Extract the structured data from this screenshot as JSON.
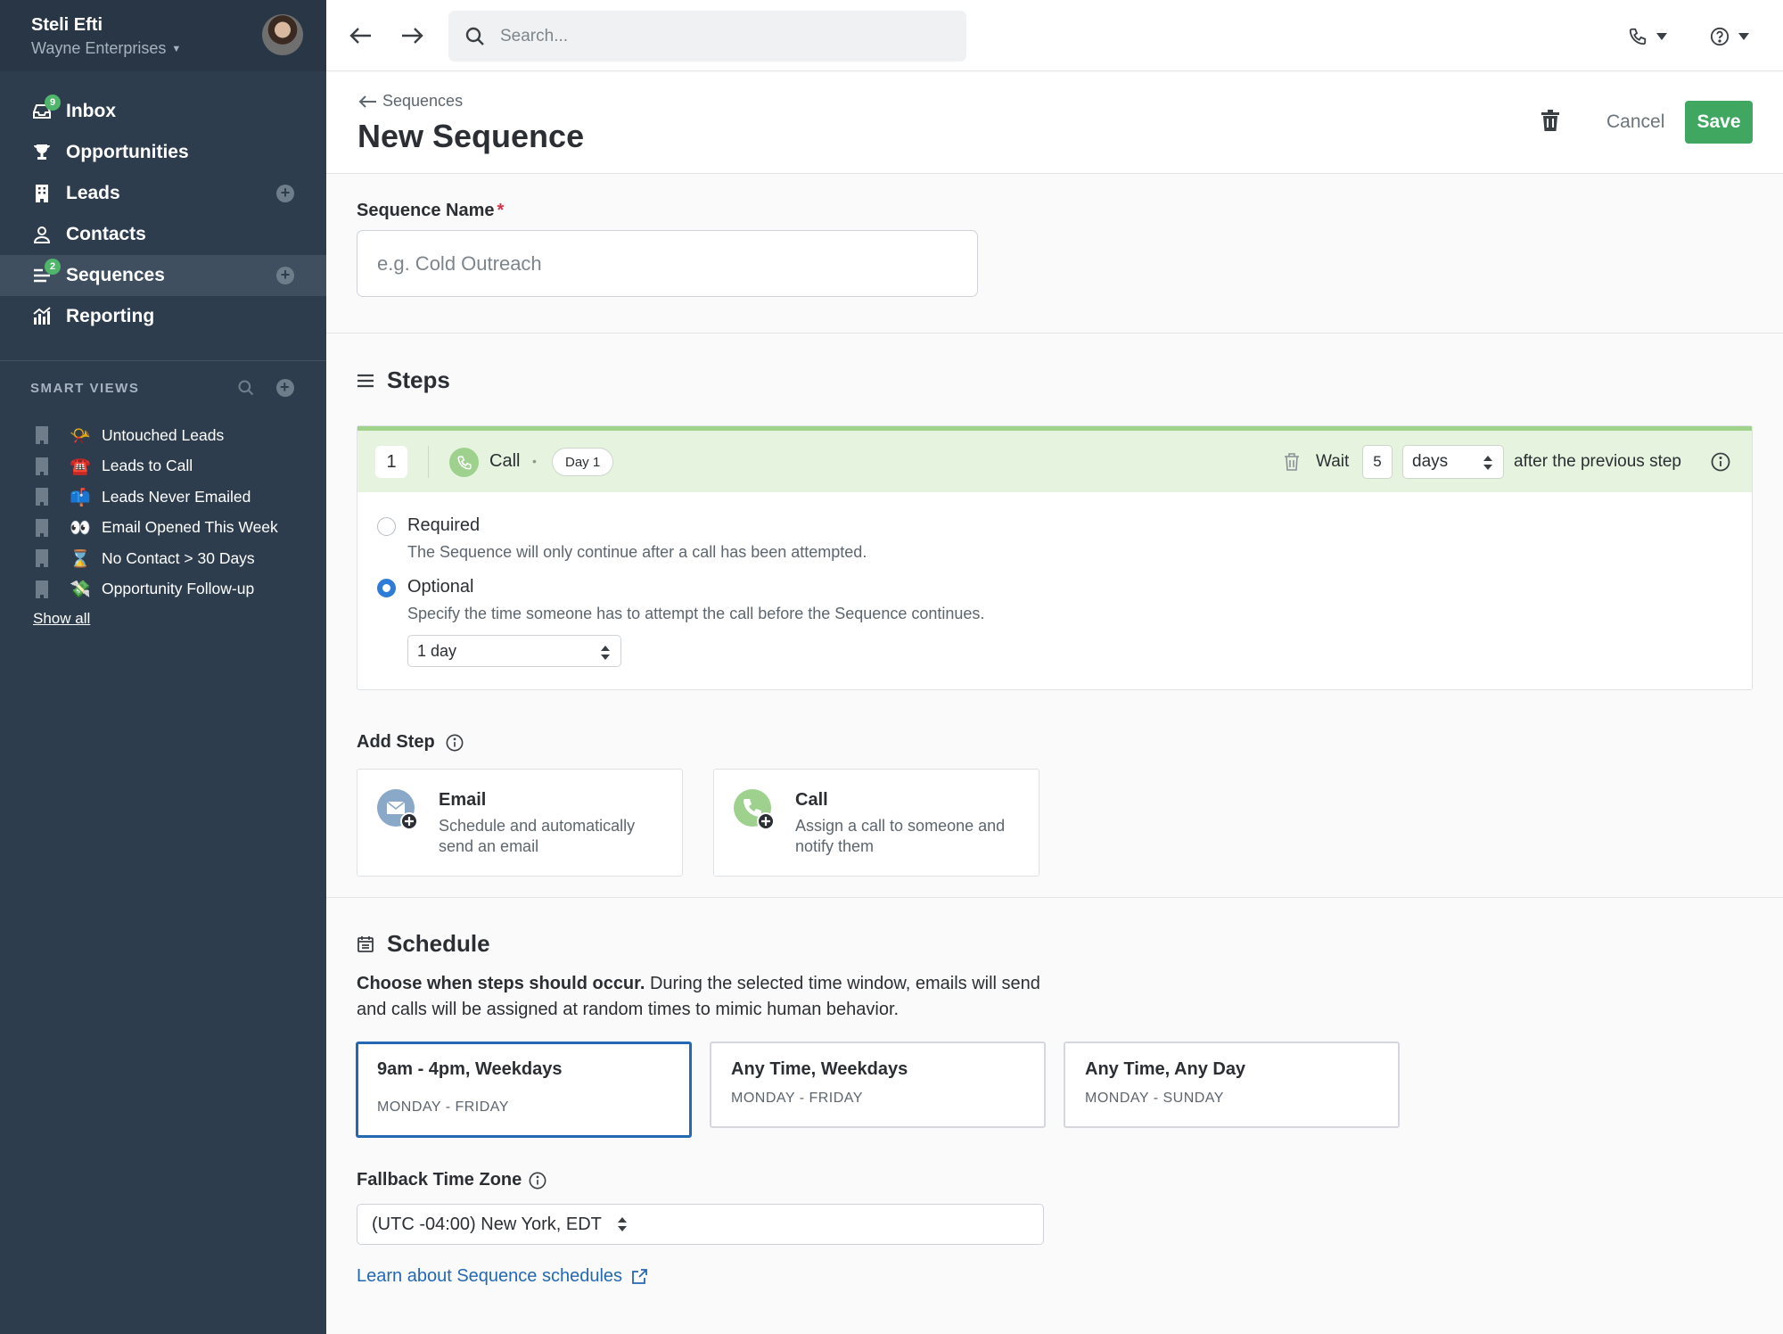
{
  "account": {
    "user_name": "Steli Efti",
    "org_name": "Wayne Enterprises"
  },
  "nav": {
    "inbox": {
      "label": "Inbox",
      "badge": "9"
    },
    "opportunities": {
      "label": "Opportunities"
    },
    "leads": {
      "label": "Leads"
    },
    "contacts": {
      "label": "Contacts"
    },
    "sequences": {
      "label": "Sequences",
      "badge": "2"
    },
    "reporting": {
      "label": "Reporting"
    }
  },
  "smart_views": {
    "heading": "SMART VIEWS",
    "items": [
      {
        "emoji": "📯",
        "label": "Untouched Leads"
      },
      {
        "emoji": "☎️",
        "label": "Leads to Call"
      },
      {
        "emoji": "📫",
        "label": "Leads Never Emailed"
      },
      {
        "emoji": "👀",
        "label": "Email Opened This Week"
      },
      {
        "emoji": "⌛",
        "label": "No Contact > 30 Days"
      },
      {
        "emoji": "💸",
        "label": "Opportunity Follow-up"
      }
    ],
    "show_all": "Show all"
  },
  "topbar": {
    "search_placeholder": "Search..."
  },
  "header": {
    "breadcrumb": "Sequences",
    "title": "New Sequence",
    "cancel_label": "Cancel",
    "save_label": "Save"
  },
  "sequence_name": {
    "label": "Sequence Name",
    "required_mark": "*",
    "placeholder": "e.g. Cold Outreach"
  },
  "steps": {
    "title": "Steps",
    "step1": {
      "number": "1",
      "type": "Call",
      "day": "Day 1",
      "wait_label": "Wait",
      "wait_value": "5",
      "wait_unit": "days",
      "after_text": "after the previous step",
      "required_label": "Required",
      "required_desc": "The Sequence will only continue after a call has been attempted.",
      "optional_label": "Optional",
      "optional_desc": "Specify the time someone has to attempt the call before the Sequence continues.",
      "selected_option": "Optional",
      "duration": "1 day"
    },
    "add_step_label": "Add Step",
    "add_email": {
      "title": "Email",
      "desc": "Schedule and automatically send an email"
    },
    "add_call": {
      "title": "Call",
      "desc": "Assign a call to someone and notify them"
    }
  },
  "schedule": {
    "title": "Schedule",
    "desc_bold": "Choose when steps should occur.",
    "desc_rest": " During the selected time window, emails will send and calls will be assigned at random times to mimic human behavior.",
    "options": [
      {
        "title": "9am - 4pm, Weekdays",
        "sub": "MONDAY - FRIDAY",
        "selected": true
      },
      {
        "title": "Any Time, Weekdays",
        "sub": "MONDAY - FRIDAY",
        "selected": false
      },
      {
        "title": "Any Time, Any Day",
        "sub": "MONDAY - SUNDAY",
        "selected": false
      }
    ],
    "tz_label": "Fallback Time Zone",
    "tz_value": "(UTC -04:00) New York, EDT",
    "learn_link": "Learn about Sequence schedules"
  },
  "colors": {
    "sidebar": "#2e3d4d",
    "accent_green": "#3fa75f",
    "link_blue": "#2468b3",
    "selected_border": "#2468b3",
    "step_header": "#e6f4df"
  }
}
